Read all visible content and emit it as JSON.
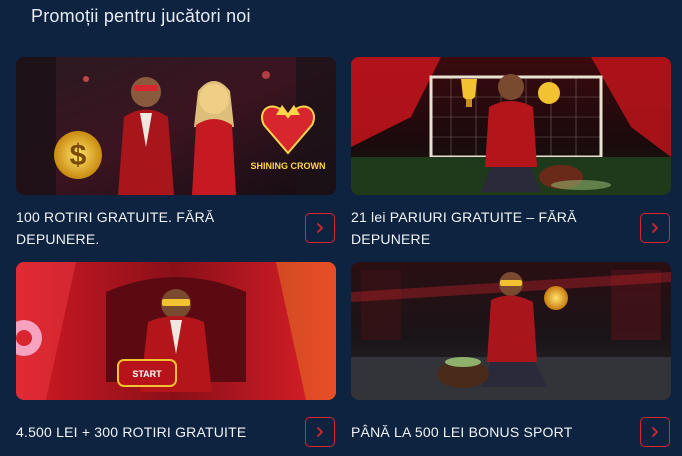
{
  "section": {
    "title": "Promoții pentru jucători noi"
  },
  "promos": [
    {
      "caption_line1": "100 ROTIRI GRATUITE. FĂRĂ",
      "caption_line2": "DEPUNERE.",
      "image_text": "SHINING CROWN",
      "button_icon": "chevron-right-icon"
    },
    {
      "caption_line1": "21 lei PARIURI GRATUITE – FĂRĂ",
      "caption_line2": "DEPUNERE",
      "button_icon": "chevron-right-icon"
    },
    {
      "caption_line1": "4.500 LEI + 300 ROTIRI GRATUITE",
      "image_text": "START",
      "button_icon": "chevron-right-icon"
    },
    {
      "caption_line1": "PÂNĂ LA 500 LEI BONUS SPORT",
      "button_icon": "chevron-right-icon"
    }
  ],
  "colors": {
    "background": "#0d2340",
    "accent": "#d8262f",
    "text": "#f2f4f8"
  }
}
